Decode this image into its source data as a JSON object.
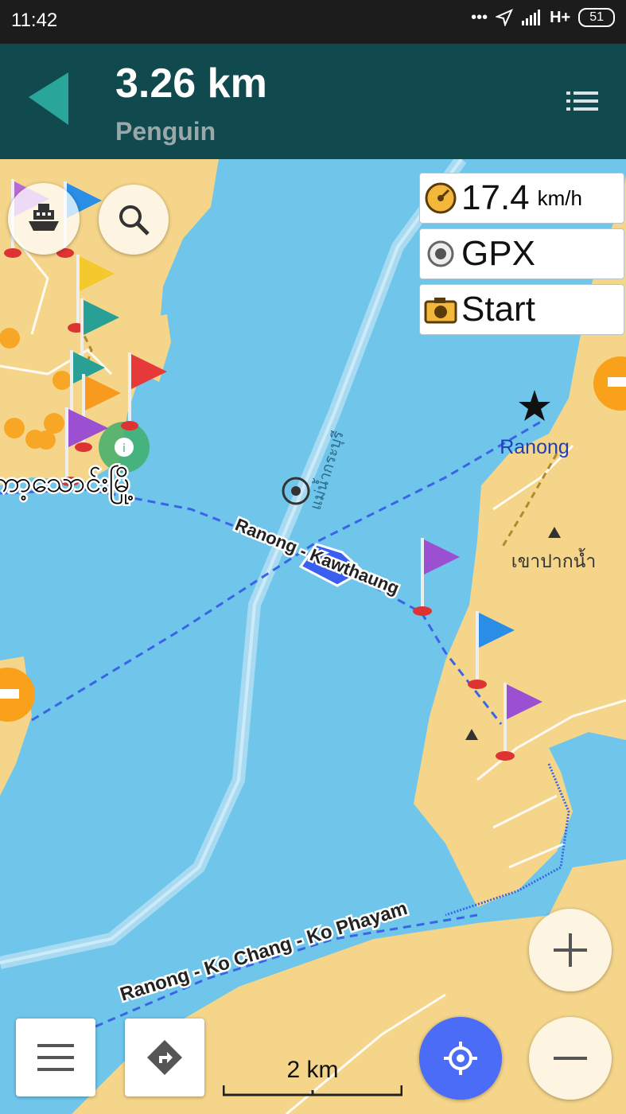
{
  "status_bar": {
    "time": "11:42",
    "network": "H+",
    "battery": "51"
  },
  "navigation": {
    "distance": "3.26 km",
    "street": "Penguin"
  },
  "widgets": {
    "speed": {
      "value": "17.4",
      "unit": "km/h"
    },
    "gpx": {
      "label": "GPX"
    },
    "camera": {
      "label": "Start"
    }
  },
  "map_labels": {
    "city": "Ranong",
    "thai_place": "เขาปากน้ำ",
    "river_thai": "แม่น้ำกระบุรี",
    "myanmar_town": "ကော့သောင်းမြို့",
    "ferry_route_1": "Ranong - Kawthaung",
    "ferry_route_2": "Ranong - Ko Chang - Ko Phayam"
  },
  "scale": {
    "label": "2 km"
  },
  "colors": {
    "water": "#6fc6ea",
    "land": "#f5d58a",
    "route": "#3a64e6",
    "nav_bar": "#104a4f",
    "arrow": "#2aa59a",
    "accent": "#4a6cf7"
  },
  "icons": {
    "turn": "turn-arrow-icon",
    "route_list": "list-icon",
    "ferry": "ferry-icon",
    "search": "search-icon",
    "speedometer": "speedometer-icon",
    "record": "record-icon",
    "camera": "camera-icon",
    "menu": "menu-icon",
    "directions": "directions-icon",
    "my_location": "my-location-icon",
    "zoom_in": "zoom-in-icon",
    "zoom_out": "zoom-out-icon",
    "location": "location-arrow-icon"
  }
}
